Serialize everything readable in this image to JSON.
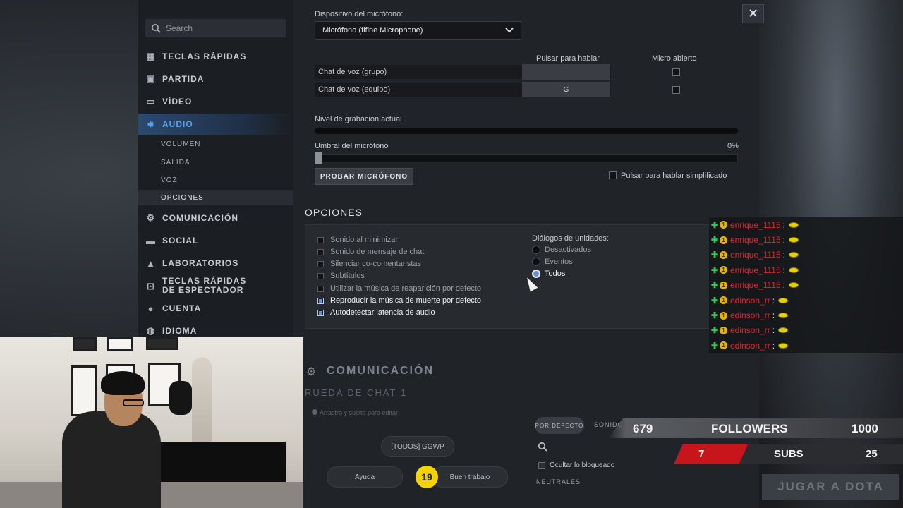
{
  "search": {
    "placeholder": "Search"
  },
  "sidebar": {
    "items": [
      {
        "label": "TECLAS RÁPIDAS",
        "icon": "grid-icon"
      },
      {
        "label": "PARTIDA",
        "icon": "game-icon"
      },
      {
        "label": "VÍDEO",
        "icon": "monitor-icon"
      },
      {
        "label": "AUDIO",
        "icon": "speaker-icon"
      },
      {
        "label": "COMUNICACIÓN",
        "icon": "gear-icon"
      },
      {
        "label": "SOCIAL",
        "icon": "chat-icon"
      },
      {
        "label": "LABORATORIOS",
        "icon": "flask-icon"
      },
      {
        "label": "TECLAS RÁPIDAS DE ESPECTADOR",
        "icon": "spectator-icon"
      },
      {
        "label": "CUENTA",
        "icon": "user-icon"
      },
      {
        "label": "IDIOMA",
        "icon": "globe-icon"
      }
    ],
    "audio_sub": [
      "VOLUMEN",
      "SALIDA",
      "VOZ",
      "OPCIONES"
    ]
  },
  "audio": {
    "mic_device_label": "Dispositivo del micrófono:",
    "mic_device_value": "Micrófono (fifine Microphone)",
    "col_ptt": "Pulsar para hablar",
    "col_open": "Micro abierto",
    "rows": [
      {
        "label": "Chat de voz (grupo)",
        "key": ""
      },
      {
        "label": "Chat de voz (equipo)",
        "key": "G"
      }
    ],
    "rec_level_label": "Nivel de grabación actual",
    "threshold_label": "Umbral del micrófono",
    "threshold_value": "0%",
    "test_button": "PROBAR MICRÓFONO",
    "simplified_ptt": "Pulsar para hablar simplificado"
  },
  "options": {
    "title": "OPCIONES",
    "checks": [
      {
        "label": "Sonido al minimizar",
        "checked": false
      },
      {
        "label": "Sonido de mensaje de chat",
        "checked": false
      },
      {
        "label": "Silenciar co-comentaristas",
        "checked": false
      },
      {
        "label": "Subtítulos",
        "checked": false
      },
      {
        "label": "Utilizar la música de reaparición por defecto",
        "checked": false
      },
      {
        "label": "Reproducir la música de muerte por defecto",
        "checked": true
      },
      {
        "label": "Autodetectar latencia de audio",
        "checked": true
      }
    ],
    "unit_dialogs_label": "Diálogos de unidades:",
    "radios": [
      {
        "label": "Desactivados",
        "selected": false
      },
      {
        "label": "Eventos",
        "selected": false
      },
      {
        "label": "Todos",
        "selected": true
      }
    ]
  },
  "communication": {
    "title": "COMUNICACIÓN",
    "wheel_title": "RUEDA DE CHAT 1",
    "drag_hint": "Arrastra y suelta para editar",
    "wheel_buttons": [
      "[TODOS] GGWP",
      "Ayuda",
      "Buen trabajo"
    ],
    "tab_default": "POR DEFECTO",
    "tab_sounds": "SONIDO",
    "hide_blocked": "Ocultar lo bloqueado",
    "neutral_header": "NEUTRALES"
  },
  "stream_chat": [
    {
      "user": "enrique_1115",
      "badge": "1"
    },
    {
      "user": "enrique_1115",
      "badge": "1"
    },
    {
      "user": "enrique_1115",
      "badge": "1"
    },
    {
      "user": "enrique_1115",
      "badge": "1"
    },
    {
      "user": "enrique_1115",
      "badge": "1"
    },
    {
      "user": "edinson_rr",
      "badge": "1"
    },
    {
      "user": "edinson_rr",
      "badge": "1"
    },
    {
      "user": "edinson_rr",
      "badge": "1"
    },
    {
      "user": "edinson_rr",
      "badge": "1"
    }
  ],
  "stream_stats": {
    "followers_current": "679",
    "followers_label": "FOLLOWERS",
    "followers_goal": "1000",
    "subs_current": "7",
    "subs_label": "SUBS",
    "subs_goal": "25"
  },
  "emote_text": "19",
  "background_button": "JUGAR A DOTA",
  "colors": {
    "accent": "#5aa0ea",
    "chat_user": "#e3262e",
    "subs_red": "#c8141b"
  }
}
